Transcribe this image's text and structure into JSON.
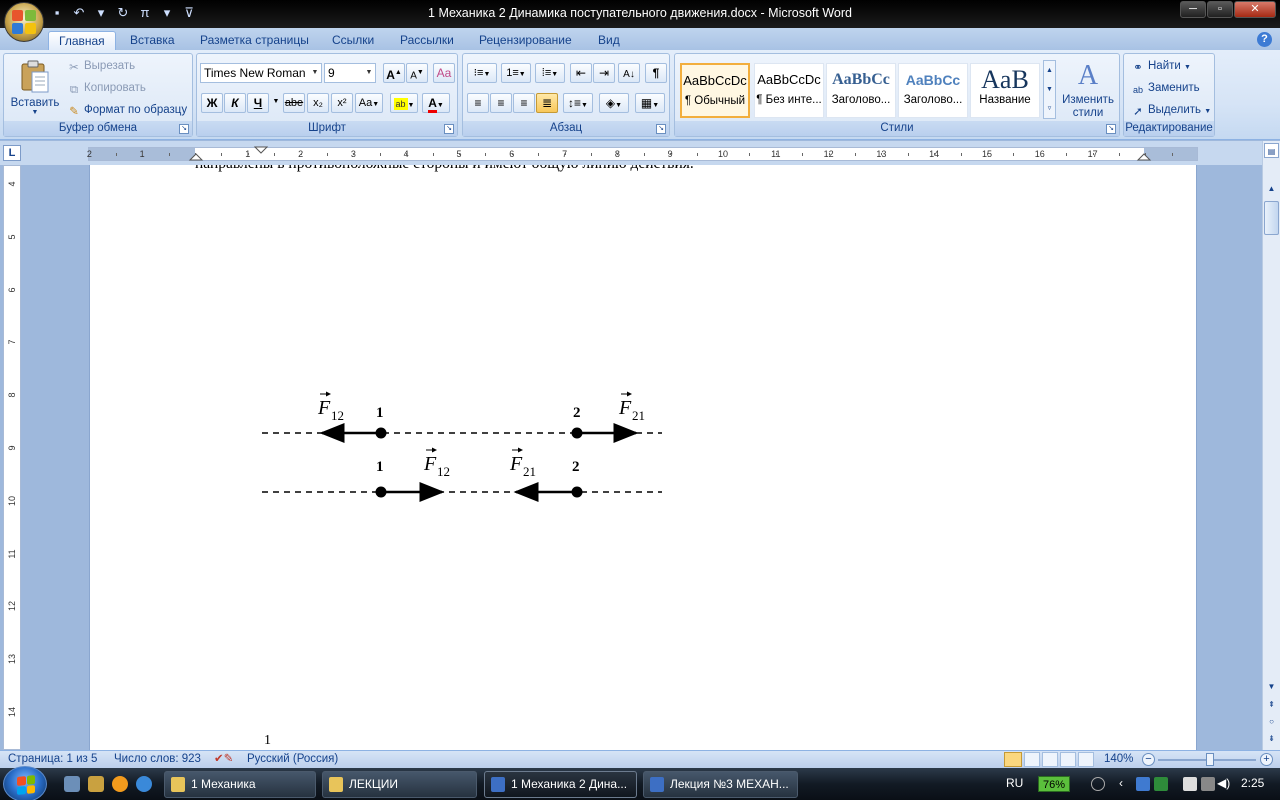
{
  "app": {
    "title": "1 Механика 2 Динамика поступательного движения.docx - Microsoft Word"
  },
  "window_controls": {
    "minimize": "─",
    "maximize": "▫",
    "close": "✕"
  },
  "tabs": [
    "Главная",
    "Вставка",
    "Разметка страницы",
    "Ссылки",
    "Рассылки",
    "Рецензирование",
    "Вид"
  ],
  "ribbon": {
    "clipboard": {
      "label": "Буфер обмена",
      "paste": "Вставить",
      "cut": "Вырезать",
      "copy": "Копировать",
      "format_painter": "Формат по образцу"
    },
    "font": {
      "label": "Шрифт",
      "font_name": "Times New Roman",
      "font_size": "9",
      "bold": "Ж",
      "italic": "К",
      "underline": "Ч",
      "strike": "abe",
      "subscript": "x₂",
      "superscript": "x²",
      "change_case": "Aa",
      "grow": "A",
      "shrink": "A"
    },
    "paragraph": {
      "label": "Абзац"
    },
    "styles": {
      "label": "Стили",
      "items": [
        {
          "sample": "AaBbCcDc",
          "name": "¶ Обычный",
          "selected": true
        },
        {
          "sample": "AaBbCcDc",
          "name": "¶ Без инте...",
          "selected": false
        },
        {
          "sample": "AaBbCc",
          "name": "Заголово...",
          "selected": false
        },
        {
          "sample": "AaBbCc",
          "name": "Заголово...",
          "selected": false
        },
        {
          "sample": "AaB",
          "name": "Название",
          "selected": false
        }
      ],
      "change_styles": "Изменить стили"
    },
    "editing": {
      "label": "Редактирование",
      "find": "Найти",
      "replace": "Заменить",
      "select": "Выделить"
    }
  },
  "ruler": {
    "h_numbers": [
      "2",
      "1",
      "1",
      "2",
      "3",
      "4",
      "5",
      "6",
      "7",
      "8",
      "9",
      "10",
      "11",
      "12",
      "13",
      "14",
      "15",
      "16",
      "17"
    ],
    "v_numbers": [
      "4",
      "5",
      "6",
      "7",
      "8",
      "9",
      "10",
      "11",
      "12",
      "13",
      "14"
    ],
    "corner": "L"
  },
  "document": {
    "cut_off_line": "направлены в противоположные стороны и имеют общую линию действия.",
    "footnote_mark": "1",
    "figure": {
      "row1": {
        "force_left": "F",
        "force_left_sub": "12",
        "point_1": "1",
        "point_2": "2",
        "force_right": "F",
        "force_right_sub": "21"
      },
      "row2": {
        "point_1": "1",
        "force_left": "F",
        "force_left_sub": "12",
        "force_right": "F",
        "force_right_sub": "21",
        "point_2": "2"
      }
    }
  },
  "status": {
    "page": "Страница: 1 из 5",
    "words": "Число слов: 923",
    "language": "Русский (Россия)",
    "zoom": "140%"
  },
  "taskbar": {
    "tasks": [
      {
        "label": "1 Механика",
        "active": false
      },
      {
        "label": "ЛЕКЦИИ",
        "active": false
      },
      {
        "label": "1 Механика 2 Дина...",
        "active": true
      },
      {
        "label": "Лекция №3 МЕХАН...",
        "active": false
      }
    ],
    "lang": "RU",
    "battery": "76%",
    "clock": "2:25"
  },
  "colors": {
    "accent": "#15428b",
    "ribbon_bg": "#d6e4f6",
    "doc_bg": "#9eb8dc"
  }
}
